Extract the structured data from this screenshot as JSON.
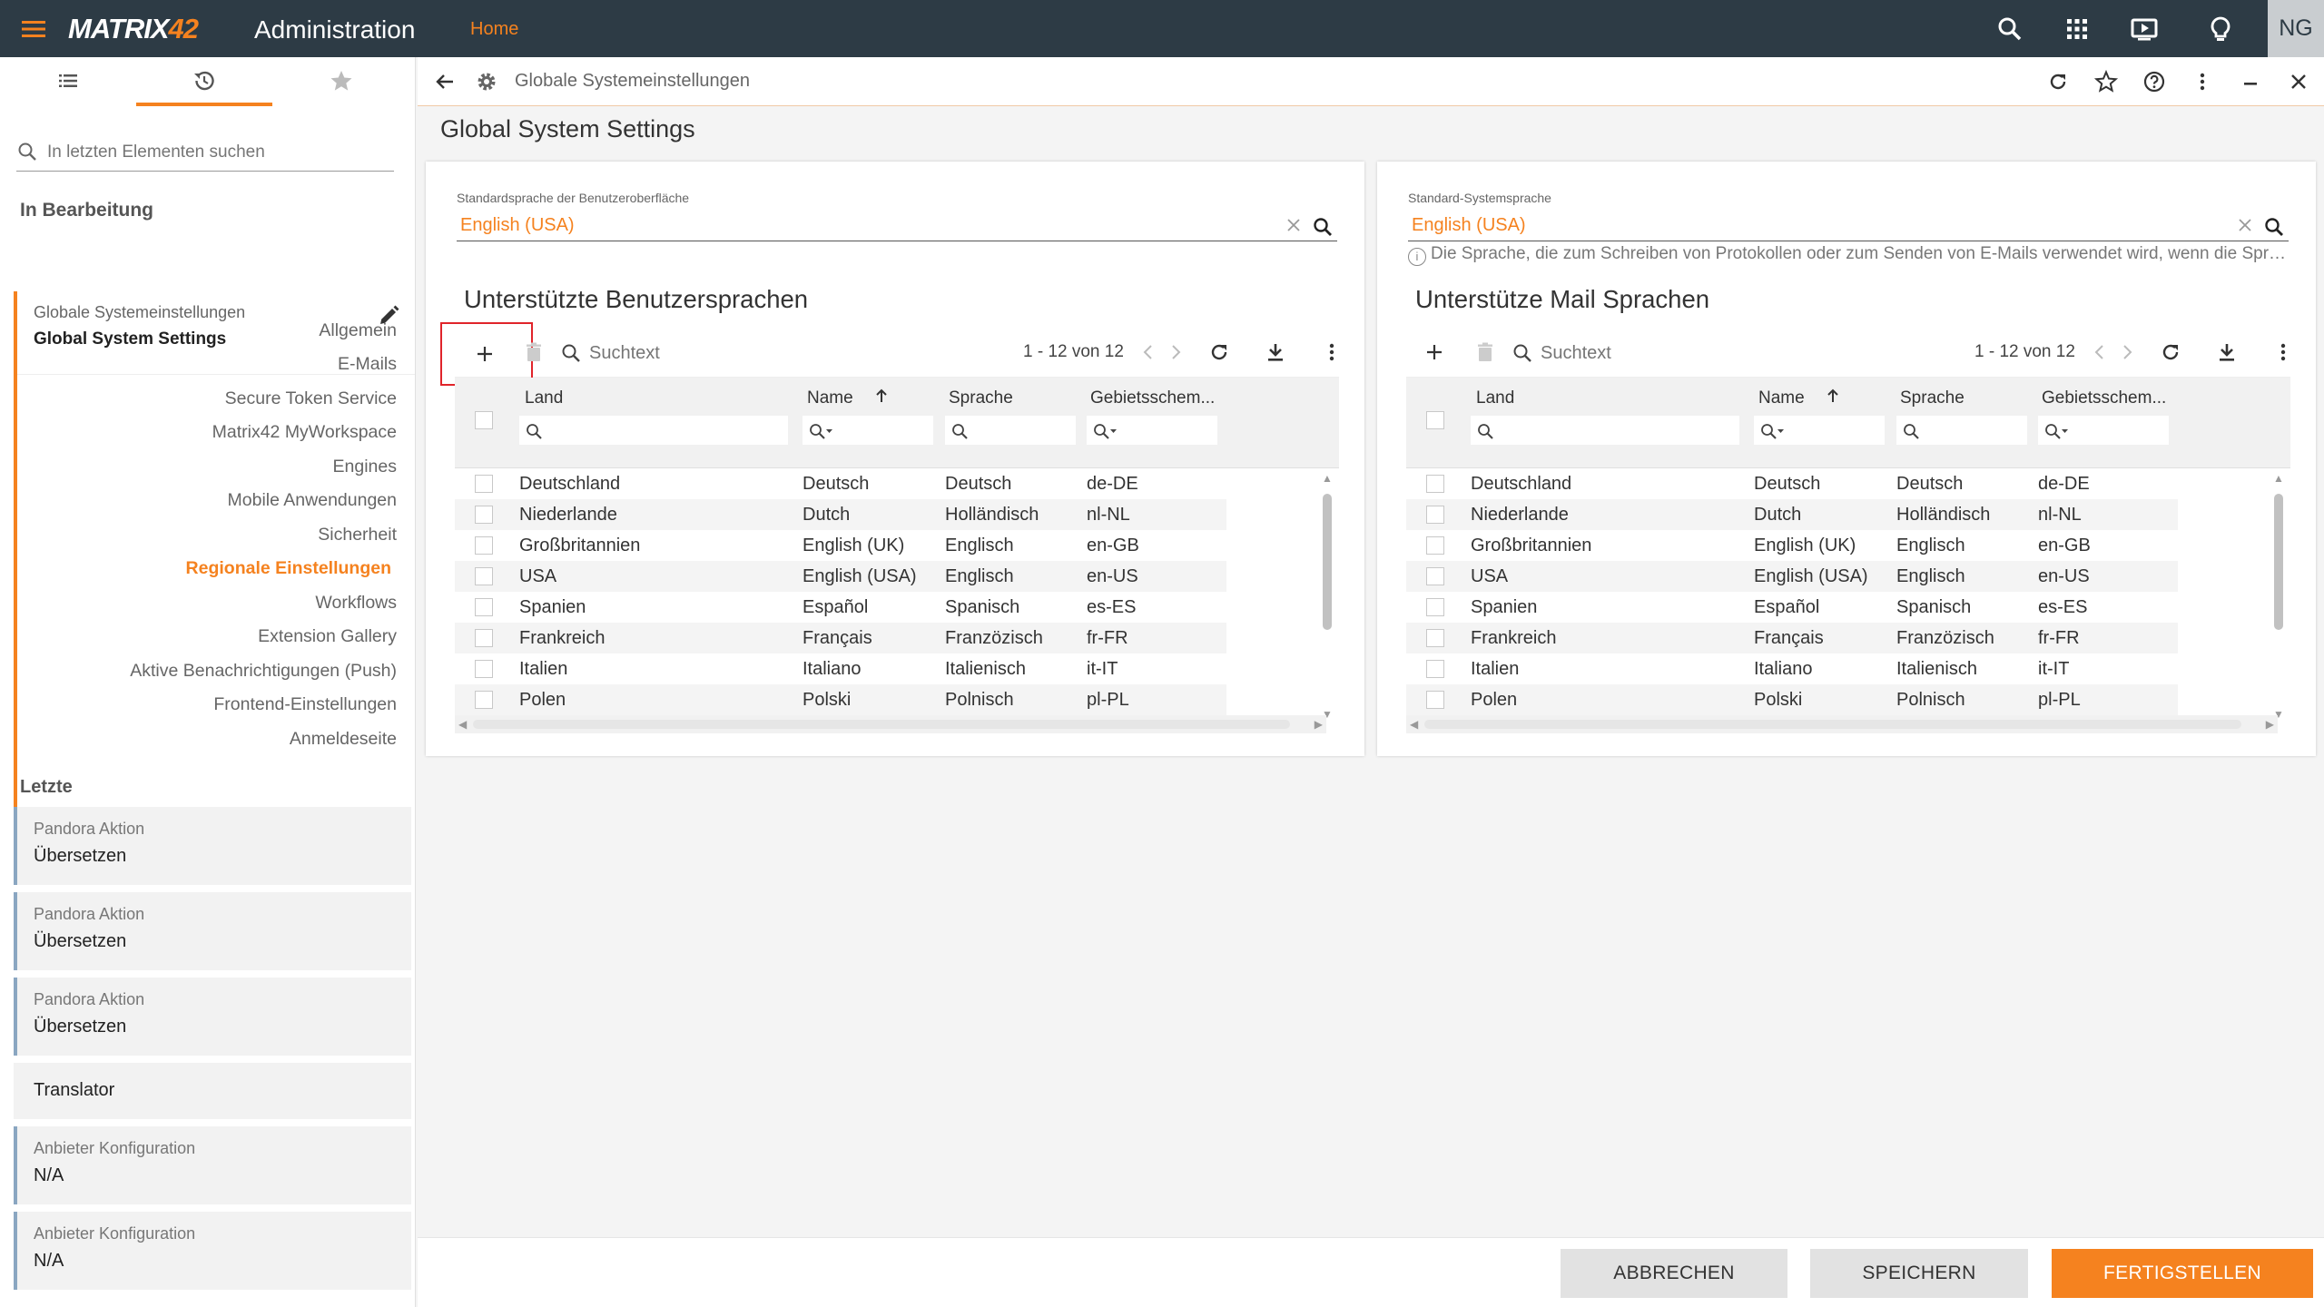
{
  "topbar": {
    "logo_main": "MATRIX",
    "logo_num": "42",
    "title": "Administration",
    "home": "Home",
    "avatar": "NG",
    "icons": [
      "search-icon",
      "apps-icon",
      "presentation-icon",
      "lightbulb-icon"
    ],
    "accent": "#f5821f",
    "background": "#2d3b45"
  },
  "sidebar": {
    "search_placeholder": "In letzten Elementen suchen",
    "editing_heading": "In Bearbeitung",
    "edit_item": {
      "sub": "Globale Systemeinstellungen",
      "main": "Global System Settings"
    },
    "nav": [
      {
        "label": "Allgemein",
        "active": false
      },
      {
        "label": "E-Mails",
        "active": false
      },
      {
        "label": "Secure Token Service",
        "active": false
      },
      {
        "label": "Matrix42 MyWorkspace",
        "active": false
      },
      {
        "label": "Engines",
        "active": false
      },
      {
        "label": "Mobile Anwendungen",
        "active": false
      },
      {
        "label": "Sicherheit",
        "active": false
      },
      {
        "label": "Regionale Einstellungen",
        "active": true
      },
      {
        "label": "Workflows",
        "active": false
      },
      {
        "label": "Extension Gallery",
        "active": false
      },
      {
        "label": "Aktive Benachrichtigungen (Push)",
        "active": false
      },
      {
        "label": "Frontend-Einstellungen",
        "active": false
      },
      {
        "label": "Anmeldeseite",
        "active": false
      }
    ],
    "recent_heading": "Letzte",
    "recent": [
      {
        "sub": "Pandora Aktion",
        "main": "Übersetzen"
      },
      {
        "sub": "Pandora Aktion",
        "main": "Übersetzen"
      },
      {
        "sub": "Pandora Aktion",
        "main": "Übersetzen"
      },
      {
        "sub": "",
        "main": "Translator"
      },
      {
        "sub": "Anbieter Konfiguration",
        "main": "N/A"
      },
      {
        "sub": "Anbieter Konfiguration",
        "main": "N/A"
      }
    ]
  },
  "breadcrumb": {
    "text": "Globale Systemeinstellungen"
  },
  "page_title": "Global System Settings",
  "panels": {
    "left": {
      "field_label": "Standardsprache der Benutzeroberfläche",
      "field_value": "English (USA)",
      "hint": "",
      "section_title": "Unterstützte Benutzersprachen"
    },
    "right": {
      "field_label": "Standard-Systemsprache",
      "field_value": "English (USA)",
      "hint": "Die Sprache, die zum Schreiben von Protokollen oder zum Senden von E-Mails verwendet wird, wenn die Sprache...",
      "section_title": "Unterstütze Mail Sprachen"
    }
  },
  "grid": {
    "search_placeholder": "Suchtext",
    "count": "1 - 12 von 12",
    "columns": [
      "Land",
      "Name",
      "Sprache",
      "Gebietsschem..."
    ],
    "sorted_column": "Name",
    "rows": [
      [
        "Deutschland",
        "Deutsch",
        "Deutsch",
        "de-DE"
      ],
      [
        "Niederlande",
        "Dutch",
        "Holländisch",
        "nl-NL"
      ],
      [
        "Großbritannien",
        "English (UK)",
        "Englisch",
        "en-GB"
      ],
      [
        "USA",
        "English (USA)",
        "Englisch",
        "en-US"
      ],
      [
        "Spanien",
        "Español",
        "Spanisch",
        "es-ES"
      ],
      [
        "Frankreich",
        "Français",
        "Franzözisch",
        "fr-FR"
      ],
      [
        "Italien",
        "Italiano",
        "Italienisch",
        "it-IT"
      ],
      [
        "Polen",
        "Polski",
        "Polnisch",
        "pl-PL"
      ]
    ]
  },
  "footer": {
    "cancel": "ABBRECHEN",
    "save": "SPEICHERN",
    "finish": "FERTIGSTELLEN"
  }
}
